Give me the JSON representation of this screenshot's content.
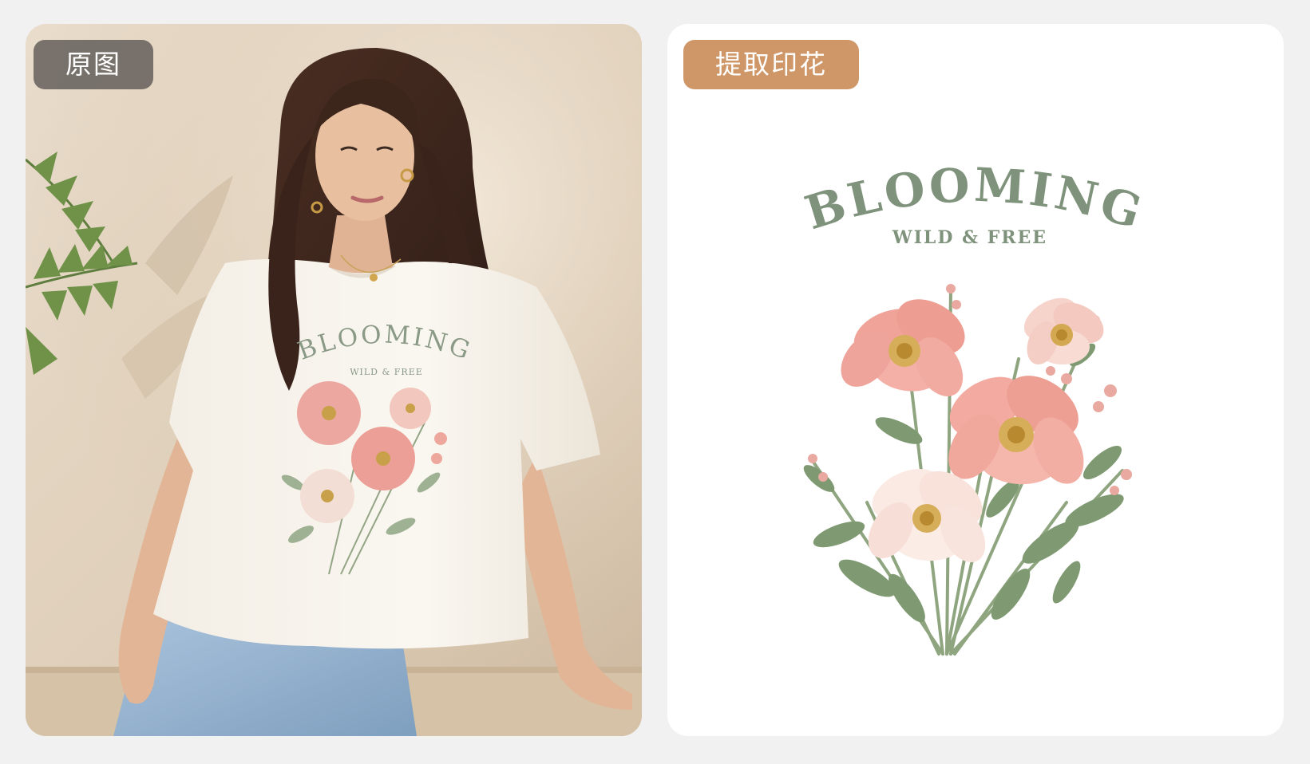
{
  "tags": {
    "original": "原图",
    "extracted": "提取印花"
  },
  "shirt_print": {
    "title": "BLOOMING",
    "subtitle": "WILD & FREE"
  },
  "extracted_print": {
    "title": "BLOOMING",
    "subtitle": "WILD & FREE"
  },
  "colors": {
    "tag_original": "#68625e",
    "tag_extracted": "#cf9767",
    "print_text": "#7f937c",
    "petal_pink": "#ee9f94",
    "leaf_green": "#7f9a72"
  }
}
